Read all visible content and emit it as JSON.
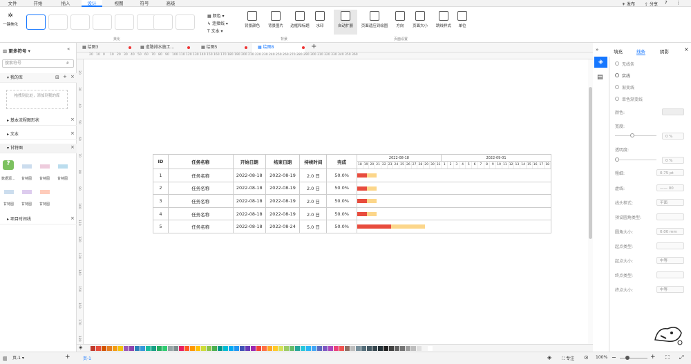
{
  "menu": {
    "tabs": [
      "文件",
      "开始",
      "插入",
      "设计",
      "视图",
      "符号",
      "高级"
    ],
    "active": "设计",
    "right": [
      "发布",
      "分享"
    ]
  },
  "ribbon": {
    "beautify": "一键美化",
    "beautify_group": "美化",
    "color": "颜色",
    "connector": "连接线",
    "text": "文本",
    "bg_group_items": [
      "背景颜色",
      "背景图片",
      "边框和标题",
      "水印"
    ],
    "bg_group_label": "背景",
    "page_items": [
      "自动扩展",
      "页面适应到绘图",
      "方向",
      "页面大小",
      "跳线样式",
      "单位"
    ],
    "page_group_label": "页面设置"
  },
  "left_panel": {
    "title": "更多符号",
    "search_placeholder": "搜索符号",
    "my_library": "我的库",
    "drop_hint": "拖拽到此处，添加到我的库",
    "sections": [
      "基本流程图形状",
      "文本"
    ],
    "gantt_section": "甘特图",
    "shapes": [
      "数据源...",
      "甘特图",
      "甘特图",
      "甘特图",
      "甘特图",
      "甘特图",
      "甘特图"
    ],
    "project_timeline": "项目时间线"
  },
  "doc_tabs": [
    "绘图3",
    "道路排水施工...",
    "绘图5",
    "绘图8"
  ],
  "active_doc_tab": "绘图8",
  "ruler_h": [
    "20",
    "10",
    "0",
    "10",
    "20",
    "30",
    "40",
    "50",
    "60",
    "70",
    "80",
    "90",
    "100",
    "110",
    "120",
    "130",
    "140",
    "150",
    "160",
    "170",
    "180",
    "190",
    "200",
    "210",
    "220",
    "230",
    "240",
    "250",
    "260",
    "270",
    "280",
    "290",
    "300",
    "310",
    "320",
    "330",
    "340",
    "350",
    "360"
  ],
  "ruler_v": [
    "20",
    "30",
    "40",
    "50",
    "60",
    "70",
    "80",
    "90",
    "100",
    "110",
    "120",
    "130",
    "140",
    "150",
    "160",
    "170",
    "180"
  ],
  "gantt": {
    "headers": [
      "ID",
      "任务名称",
      "开始日期",
      "结束日期",
      "持续时间",
      "完成"
    ],
    "week1": "2022-08-18",
    "week2": "2022-09-01",
    "days": [
      "18",
      "19",
      "20",
      "21",
      "22",
      "23",
      "24",
      "25",
      "26",
      "27",
      "28",
      "29",
      "30",
      "31",
      "1",
      "2",
      "3",
      "4",
      "5",
      "6",
      "7",
      "8",
      "9",
      "10",
      "11",
      "12",
      "13",
      "14",
      "15",
      "16",
      "17",
      "18"
    ],
    "rows": [
      {
        "id": "1",
        "name": "任务名称",
        "start": "2022-08-18",
        "end": "2022-08-19",
        "dur": "2.0 日",
        "done": "50.0%"
      },
      {
        "id": "2",
        "name": "任务名称",
        "start": "2022-08-18",
        "end": "2022-08-19",
        "dur": "2.0 日",
        "done": "50.0%"
      },
      {
        "id": "3",
        "name": "任务名称",
        "start": "2022-08-18",
        "end": "2022-08-19",
        "dur": "2.0 日",
        "done": "50.0%"
      },
      {
        "id": "4",
        "name": "任务名称",
        "start": "2022-08-18",
        "end": "2022-08-19",
        "dur": "2.0 日",
        "done": "50.0%"
      },
      {
        "id": "5",
        "name": "任务名称",
        "start": "2022-08-18",
        "end": "2022-08-24",
        "dur": "5.0 日",
        "done": "50.0%"
      }
    ],
    "bar_done_color": "#e84c3d",
    "bar_rest_color": "#fcd68a"
  },
  "right_panel": {
    "tabs": [
      "填充",
      "线条",
      "阴影"
    ],
    "active_tab": "线条",
    "line_options": [
      "无线条",
      "实线",
      "渐变线",
      "单色渐变线"
    ],
    "labels": {
      "color": "颜色:",
      "width": "宽度:",
      "width_val": "0 %",
      "opacity": "透明度:",
      "opacity_val": "0 %",
      "thickness": "粗细:",
      "thickness_val": "0.75 pt",
      "dash": "虚线:",
      "dash_val": "—— 00",
      "cap": "线头样式:",
      "cap_val": "平面",
      "join": "预设圆角类型:",
      "radius": "圆角大小:",
      "radius_val": "0.00 mm",
      "start_type": "起点类型:",
      "start_size": "起点大小:",
      "start_size_val": "中等",
      "end_type": "终点类型:",
      "end_size": "终点大小:",
      "end_size_val": "中等"
    }
  },
  "status": {
    "page_select": "页-1",
    "page_tab": "页-1",
    "focus": "专注",
    "zoom": "100%"
  },
  "palette": [
    "#c0392b",
    "#e74c3c",
    "#d35400",
    "#e67e22",
    "#f39c12",
    "#f1c40f",
    "#9b59b6",
    "#8e44ad",
    "#2980b9",
    "#3498db",
    "#1abc9c",
    "#16a085",
    "#27ae60",
    "#2ecc71",
    "#95a5a6",
    "#7f8c8d",
    "#e91e63",
    "#ff5722",
    "#ff9800",
    "#ffc107",
    "#cddc39",
    "#8bc34a",
    "#4caf50",
    "#009688",
    "#00bcd4",
    "#03a9f4",
    "#2196f3",
    "#3f51b5",
    "#673ab7",
    "#9c27b0",
    "#f44336",
    "#ff7043",
    "#ffa726",
    "#ffca28",
    "#d4e157",
    "#9ccc65",
    "#66bb6a",
    "#26a69a",
    "#26c6da",
    "#29b6f6",
    "#42a5f5",
    "#5c6bc0",
    "#7e57c2",
    "#ab47bc",
    "#ec407a",
    "#ef5350",
    "#8d6e63",
    "#bdbdbd",
    "#78909c",
    "#546e7a",
    "#455a64",
    "#37474f",
    "#263238",
    "#212121",
    "#424242",
    "#616161",
    "#757575",
    "#9e9e9e",
    "#bdbdbd",
    "#e0e0e0",
    "#f5f5f5",
    "#ffffff"
  ]
}
